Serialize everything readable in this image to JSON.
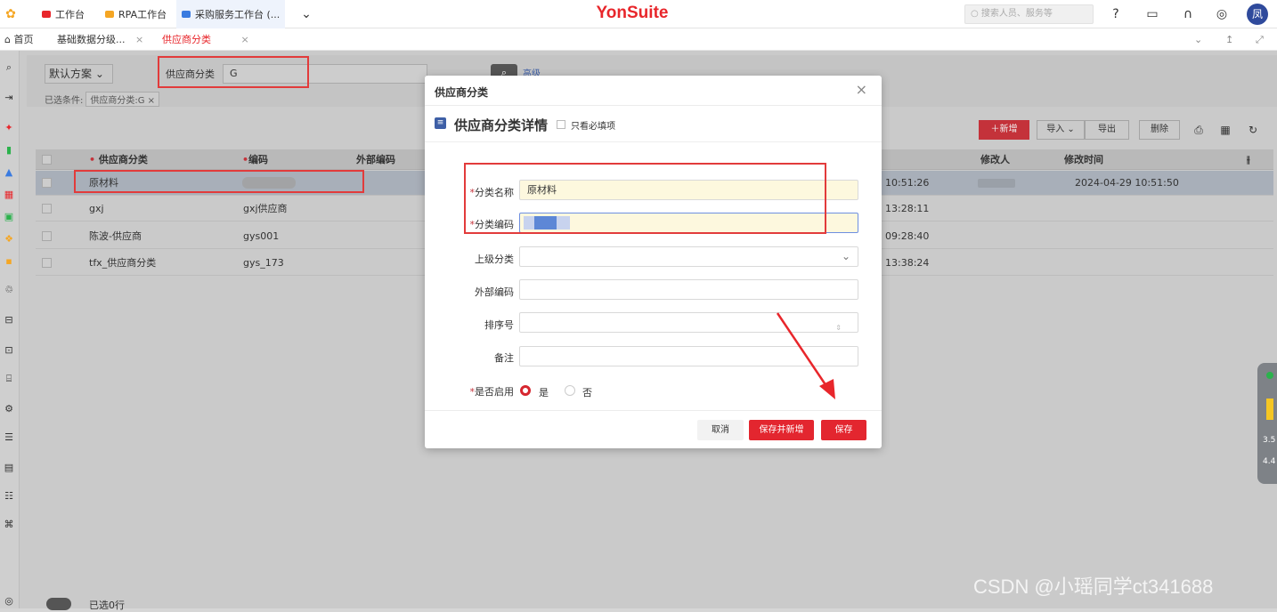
{
  "topbar": {
    "apps": [
      {
        "label": "工作台",
        "color": "#e8262b"
      },
      {
        "label": "RPA工作台",
        "color": "#f5a623"
      },
      {
        "label": "采购服务工作台 (...",
        "color": "#3a7be0"
      }
    ],
    "brand": "YonSuite",
    "search_placeholder": "搜索人员、服务等",
    "avatar": "凤"
  },
  "tabs": [
    {
      "label": "首页"
    },
    {
      "label": "基础数据分级..."
    },
    {
      "label": "供应商分类"
    }
  ],
  "filter": {
    "scheme": "默认方案",
    "field_label": "供应商分类",
    "field_value": "G",
    "advanced": "高级",
    "selected_prefix": "已选条件:",
    "selected_tag": "供应商分类:G"
  },
  "toolbar": {
    "new": "新增",
    "import": "导入",
    "export": "导出",
    "delete": "删除"
  },
  "grid": {
    "columns": {
      "category": "供应商分类",
      "code": "编码",
      "external_code": "外部编码",
      "modifier": "修改人",
      "modified_time": "修改时间"
    },
    "rows": [
      {
        "category": "原材料",
        "time_partial": "10:51:26",
        "modified_time": "2024-04-29 10:51:50"
      },
      {
        "category": "gxj",
        "code": "gxj供应商",
        "time_partial": "13:28:11"
      },
      {
        "category": "陈波-供应商",
        "code": "gys001",
        "time_partial": "09:28:40"
      },
      {
        "category": "tfx_供应商分类",
        "code": "gys_173",
        "time_partial": "13:38:24"
      }
    ],
    "selected_count": "已选0行"
  },
  "dialog": {
    "title": "供应商分类",
    "section_title": "供应商分类详情",
    "required_only": "只看必填项",
    "fields": {
      "name_label": "分类名称",
      "name_value": "原材料",
      "code_label": "分类编码",
      "parent_label": "上级分类",
      "external_label": "外部编码",
      "order_label": "排序号",
      "remark_label": "备注",
      "enabled_label": "是否启用",
      "yes": "是",
      "no": "否"
    },
    "buttons": {
      "cancel": "取消",
      "save_new": "保存并新增",
      "save": "保存"
    }
  },
  "side_widget": {
    "v1": "3.5",
    "v2": "4.4"
  },
  "watermark": "CSDN @小瑶同学ct341688"
}
